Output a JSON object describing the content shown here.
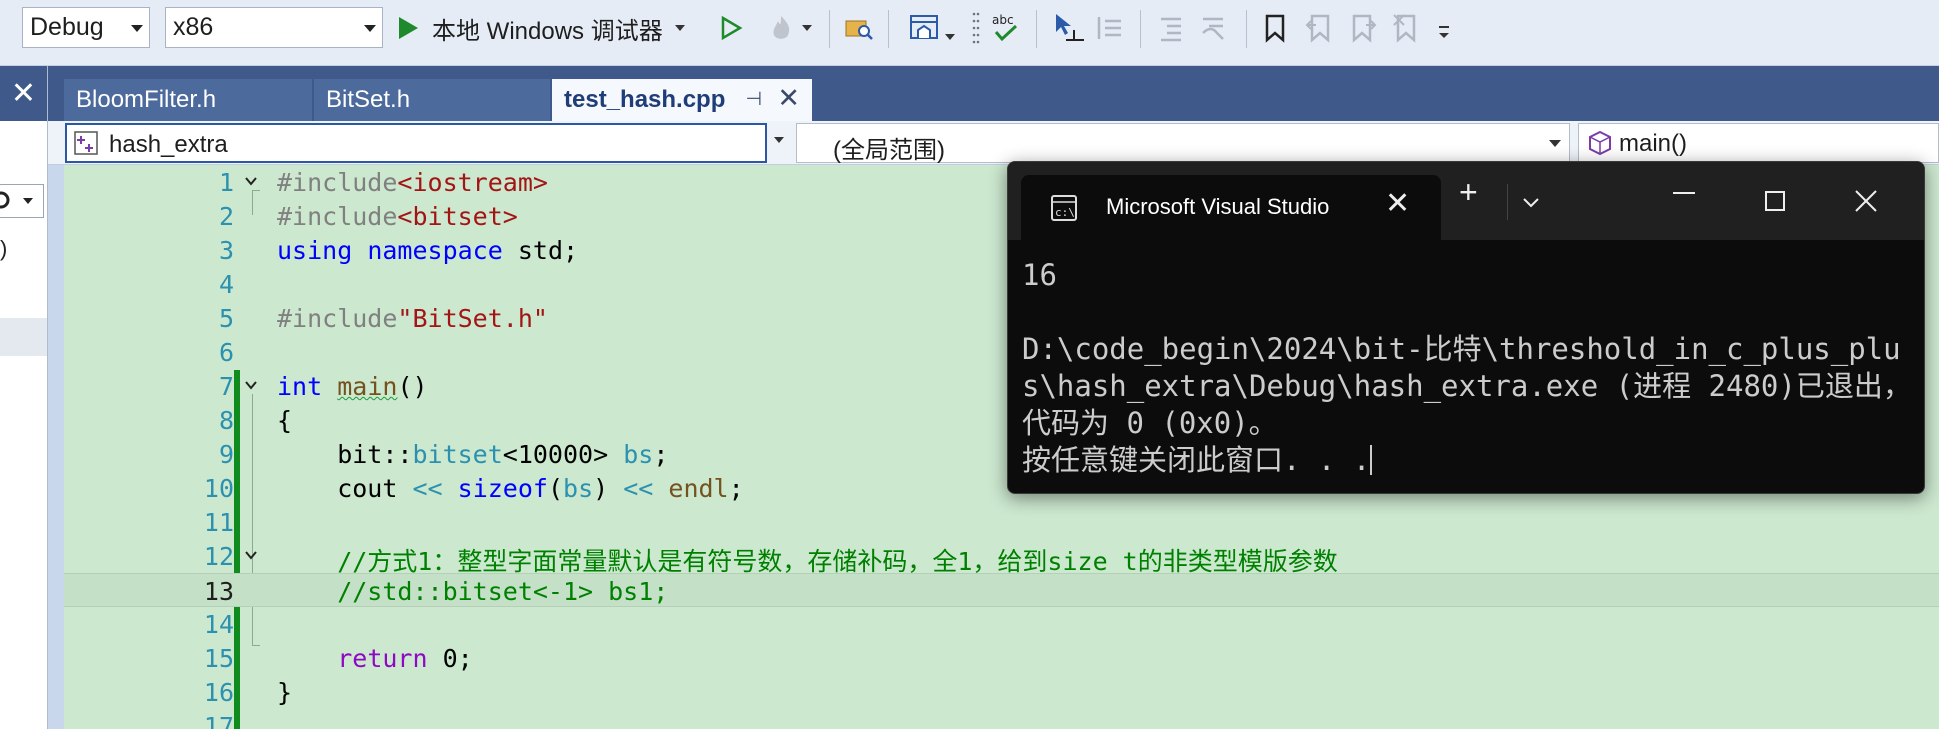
{
  "toolbar": {
    "config": "Debug",
    "platform": "x86",
    "run_label": "本地 Windows 调试器"
  },
  "tabs": [
    {
      "label": "BloomFilter.h",
      "active": false
    },
    {
      "label": "BitSet.h",
      "active": false
    },
    {
      "label": "test_hash.cpp",
      "active": true
    }
  ],
  "navbar": {
    "project": "hash_extra",
    "scope": "(全局范围)",
    "member": "main()"
  },
  "editor": {
    "current_line": 13,
    "line_numbers": [
      "1",
      "2",
      "3",
      "4",
      "5",
      "6",
      "7",
      "8",
      "9",
      "10",
      "11",
      "12",
      "13",
      "14",
      "15",
      "16",
      "17"
    ]
  },
  "console": {
    "title": "Microsoft Visual Studio",
    "output": "16\n\nD:\\code_begin\\2024\\bit-比特\\threshold_in_c_plus_plus\\hash_extra\\Debug\\hash_extra.exe (进程 2480)已退出，代码为 0 (0x0)。\n按任意键关闭此窗口. . ."
  },
  "colors": {
    "editor_bg": "#cce8cf",
    "keyword": "#0000ff",
    "comment": "#008000",
    "string": "#a31515",
    "tab_strip": "#3f5a8a",
    "console_bg": "#0c0c0c"
  }
}
